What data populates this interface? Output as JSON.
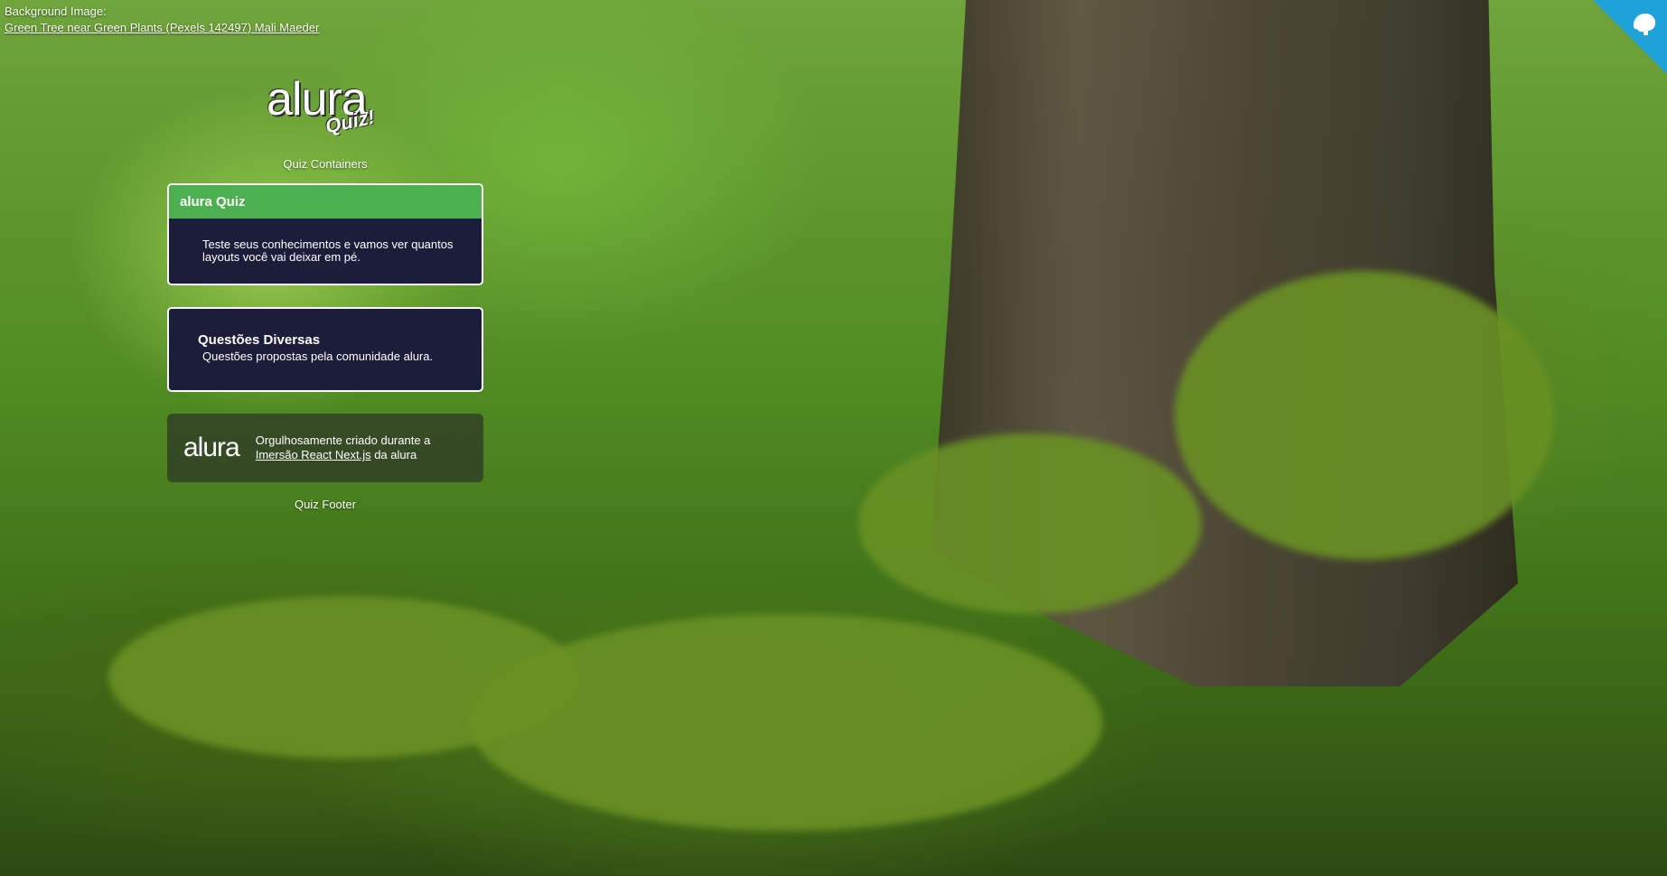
{
  "credit": {
    "label": "Background Image:",
    "link_text": "Green Tree near Green Plants (Pexels 142497) Mali Maeder"
  },
  "logo": {
    "brand": "alura",
    "sub": "Quiz!"
  },
  "containers_label": "Quiz Containers",
  "quiz_widget": {
    "title": "alura Quiz",
    "description": "Teste seus conhecimentos e vamos ver quantos layouts você vai deixar em pé."
  },
  "topics_widget": {
    "title": "Questões Diversas",
    "description": "Questões propostas pela comunidade alura."
  },
  "footer": {
    "logo": "alura",
    "text_before": "Orgulhosamente criado durante a ",
    "link_text": "Imersão React Next.js",
    "text_after": " da alura"
  },
  "footer_label": "Quiz Footer",
  "colors": {
    "widget_bg": "#1c1d3a",
    "header_green": "#4caf50",
    "corner_blue": "#1fa2d8"
  },
  "icons": {
    "corner": "github-octocat-icon"
  }
}
